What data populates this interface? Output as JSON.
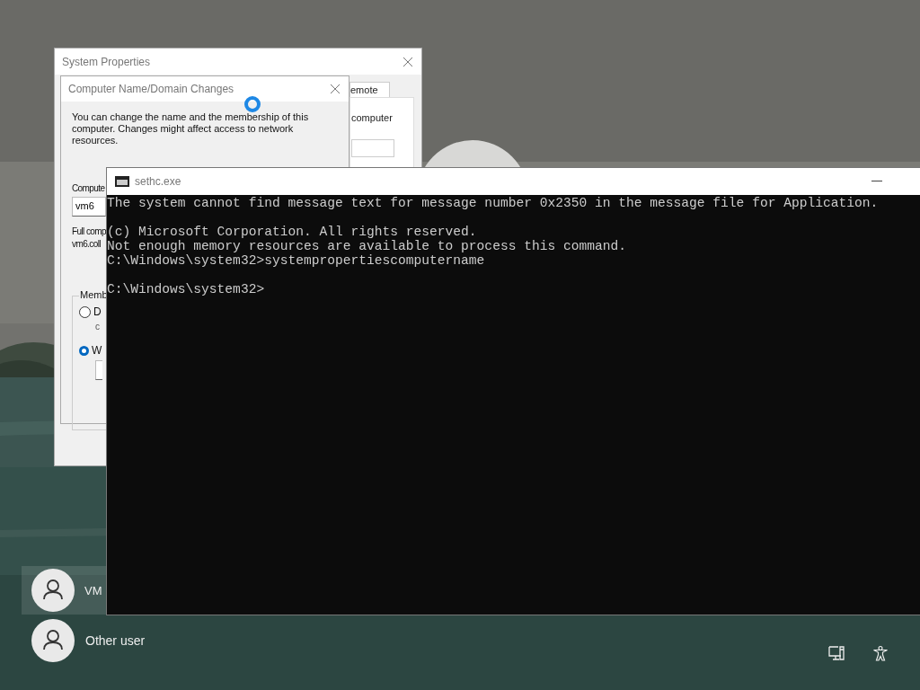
{
  "lock_screen": {
    "users": [
      {
        "name": "VM",
        "selected": true
      },
      {
        "name": "Other user",
        "selected": false
      }
    ]
  },
  "system_properties": {
    "title": "System Properties",
    "tab": "emote",
    "panel_text": "computer"
  },
  "name_dialog": {
    "title": "Computer Name/Domain Changes",
    "intro": "You can change the name and the membership of this computer. Changes might affect access to network resources.",
    "name_label": "Compute",
    "name_value": "vm6",
    "full_label": "Full comp",
    "full_value": "vm6.coll",
    "group_label": "Memb",
    "options": [
      {
        "label": "D",
        "note": "c",
        "selected": false
      },
      {
        "label": "W",
        "selected": true
      }
    ]
  },
  "console": {
    "title": "sethc.exe",
    "blocks": [
      [
        "The system cannot find message text for message number 0x2350 in the message file for Application."
      ],
      [
        "(c) Microsoft Corporation. All rights reserved.",
        "Not enough memory resources are available to process this command.",
        "C:\\Windows\\system32>systempropertiescomputername"
      ],
      [
        "C:\\Windows\\system32>"
      ]
    ]
  }
}
